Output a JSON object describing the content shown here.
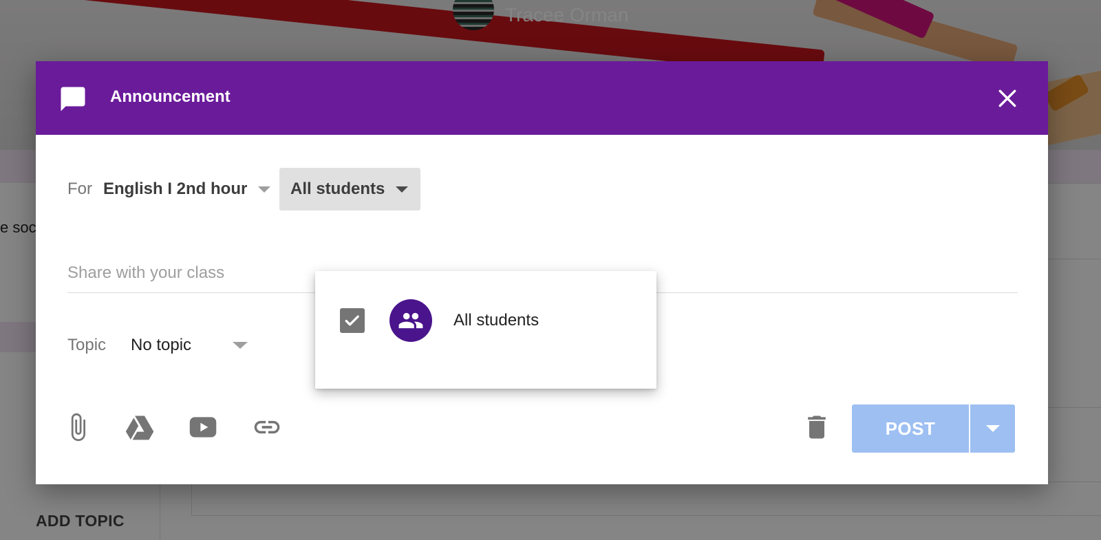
{
  "background": {
    "user_name": "Tracee Orman",
    "left_text": "e soc",
    "add_topic_label": "ADD TOPIC"
  },
  "dialog": {
    "title": "Announcement",
    "header_icon": "chat-bubble-icon",
    "close_icon": "close-icon",
    "for_label": "For",
    "class_select_value": "English I 2nd hour",
    "students_select_value": "All students",
    "share_placeholder": "Share with your class",
    "topic_label": "Topic",
    "topic_value": "No topic",
    "toolbar_icons": [
      "attach-icon",
      "drive-icon",
      "youtube-icon",
      "link-icon"
    ],
    "delete_icon": "trash-icon",
    "post_label": "POST"
  },
  "dropdown": {
    "items": [
      {
        "label": "All students",
        "checked": true,
        "icon": "people-icon"
      }
    ]
  },
  "colors": {
    "header": "#6a1b9a",
    "avatar": "#4a148c",
    "post_button_disabled": "#9dbff2",
    "selected_chip": "#e0e0e0"
  }
}
